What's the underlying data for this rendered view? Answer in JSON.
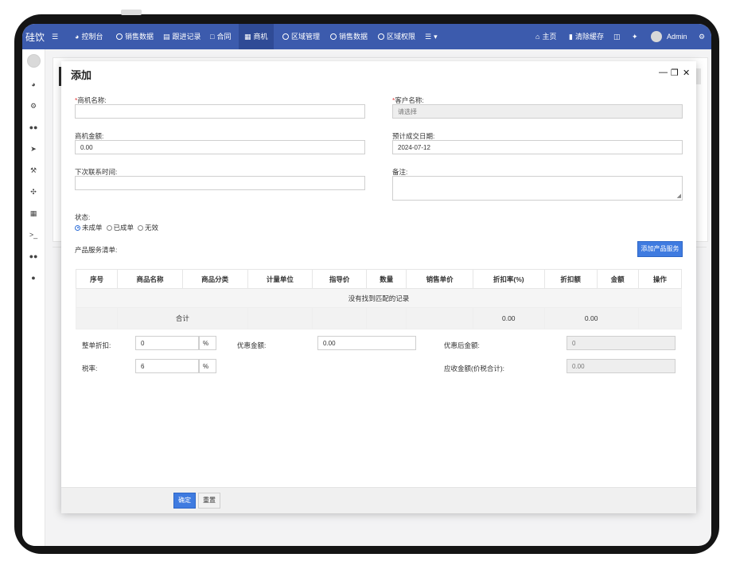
{
  "app": {
    "brand": "硅饮"
  },
  "nav": {
    "items": [
      {
        "label": "控制台",
        "icon": "dashboard-icon"
      },
      {
        "label": "销售数据",
        "icon": "circle-icon"
      },
      {
        "label": "跟进记录",
        "icon": "list-icon"
      },
      {
        "label": "合同",
        "icon": "document-icon"
      },
      {
        "label": "商机",
        "icon": "calculator-icon"
      },
      {
        "label": "区域管理",
        "icon": "circle-icon"
      },
      {
        "label": "销售数据",
        "icon": "circle-icon"
      },
      {
        "label": "区域权限",
        "icon": "circle-icon"
      }
    ],
    "home": "主页",
    "clear_cache": "清除缓存",
    "user": "Admin"
  },
  "modal": {
    "title": "添加",
    "fields": {
      "opportunity_name_label": "商机名称:",
      "customer_name_label": "客户名称:",
      "customer_placeholder": "请选择",
      "amount_label": "商机金额:",
      "amount_value": "0.00",
      "expected_date_label": "预计成交日期:",
      "expected_date_value": "2024-07-12",
      "next_contact_label": "下次联系时间:",
      "remark_label": "备注:"
    },
    "status": {
      "label": "状态:",
      "options": [
        "未成单",
        "已成单",
        "无效"
      ],
      "selected": "未成单"
    },
    "products": {
      "label": "产品服务清单:",
      "add_button": "添加产品服务",
      "columns": [
        "序号",
        "商品名称",
        "商品分类",
        "计量单位",
        "指导价",
        "数量",
        "销售单价",
        "折扣率(%)",
        "折扣额",
        "金额",
        "操作"
      ],
      "empty_text": "没有找到匹配的记录",
      "total_label": "合计",
      "total_discount": "0.00",
      "total_amount": "0.00"
    },
    "summary": {
      "whole_discount_label": "整单折扣:",
      "whole_discount_value": "0",
      "percent_unit": "%",
      "discount_amount_label": "优惠金额:",
      "discount_amount_value": "0.00",
      "after_discount_label": "优惠后金额:",
      "after_discount_value": "0",
      "tax_rate_label": "税率:",
      "tax_rate_value": "6",
      "receivable_label": "应收金额(价税合计):",
      "receivable_value": "0.00"
    },
    "buttons": {
      "confirm": "确定",
      "reset": "重置"
    }
  },
  "colors": {
    "nav_bg": "#3c5bad",
    "primary": "#3f7be0",
    "required": "#e23d3d"
  }
}
